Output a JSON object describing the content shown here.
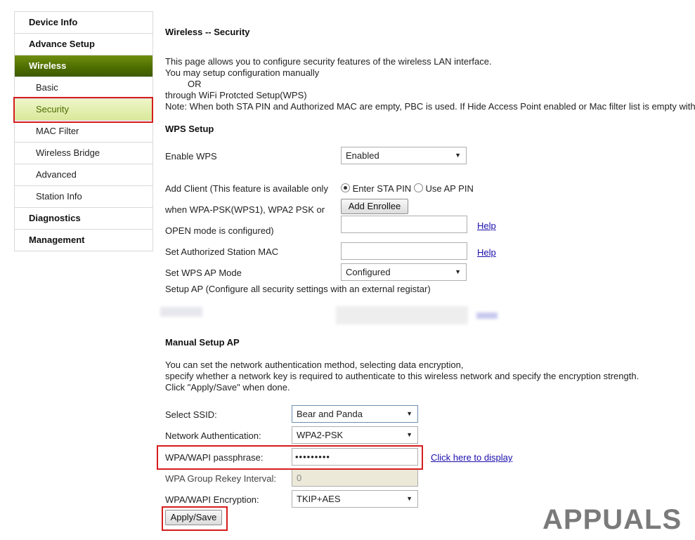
{
  "sidebar": {
    "items": [
      {
        "label": "Device Info"
      },
      {
        "label": "Advance Setup"
      },
      {
        "label": "Wireless"
      },
      {
        "label": "Basic"
      },
      {
        "label": "Security"
      },
      {
        "label": "MAC Filter"
      },
      {
        "label": "Wireless Bridge"
      },
      {
        "label": "Advanced"
      },
      {
        "label": "Station Info"
      },
      {
        "label": "Diagnostics"
      },
      {
        "label": "Management"
      }
    ]
  },
  "page": {
    "title": "Wireless -- Security",
    "intro": [
      "This page allows you to configure security features of the wireless LAN interface.",
      "You may setup configuration manually",
      "OR",
      "through WiFi Protcted Setup(WPS)",
      "Note: When both STA PIN and Authorized MAC are empty, PBC is used. If Hide Access Point enabled or Mac filter list is empty with"
    ]
  },
  "wps": {
    "title": "WPS Setup",
    "enable_label": "Enable WPS",
    "enable_value": "Enabled",
    "add_client_lines": [
      "Add Client (This feature is available only",
      "when WPA-PSK(WPS1), WPA2 PSK or",
      "OPEN mode is configured)"
    ],
    "radio_sta": "Enter STA PIN",
    "radio_ap": "Use AP PIN",
    "add_enrollee": "Add Enrollee",
    "help": "Help",
    "auth_mac_label": "Set Authorized Station MAC",
    "ap_mode_label": "Set WPS AP Mode",
    "ap_mode_value": "Configured",
    "setup_ap_text": "Setup AP (Configure all security settings with an external registar)"
  },
  "manual": {
    "title": "Manual Setup AP",
    "desc": [
      "You can set the network authentication method, selecting data encryption,",
      "specify whether a network key is required to authenticate to this wireless network and specify the encryption strength.",
      "Click \"Apply/Save\" when done."
    ],
    "ssid_label": "Select SSID:",
    "ssid_value": "Bear and Panda",
    "auth_label": "Network Authentication:",
    "auth_value": "WPA2-PSK",
    "pass_label": "WPA/WAPI passphrase:",
    "pass_value": "•••••••••",
    "display_link": "Click here to display",
    "rekey_label": "WPA Group Rekey Interval:",
    "rekey_value": "0",
    "enc_label": "WPA/WAPI Encryption:",
    "enc_value": "TKIP+AES",
    "apply": "Apply/Save"
  },
  "watermark": {
    "text": "APPUALS"
  },
  "colors": {
    "accent": "#4f6e00",
    "highlight": "#d61d1d",
    "link": "#1a0dab"
  }
}
